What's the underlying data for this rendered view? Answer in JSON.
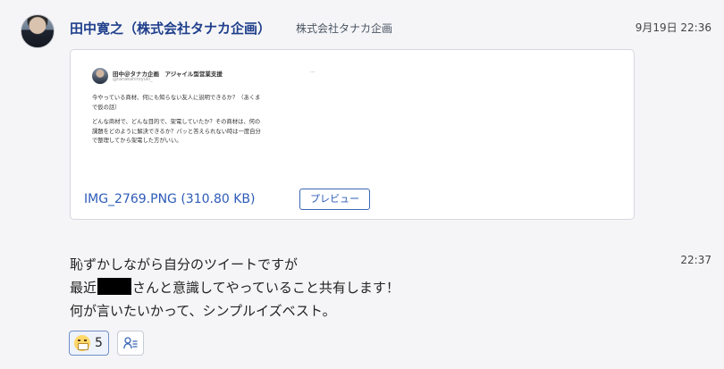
{
  "message": {
    "sender_name": "田中寛之（株式会社タナカ企画）",
    "sender_org": "株式会社タナカ企画",
    "timestamp": "9月19日 22:36"
  },
  "attachment": {
    "tweet": {
      "name": "田中＠タナカ企画　アジャイル型営業支援",
      "handle": "@tanakahiroyuki_",
      "more": "···",
      "paragraph_1": "今やっている商材、何にも知らない友人に説明できるか？（あくまで仮の話）",
      "paragraph_2": "どんな商材で、どんな目的で、架電していたか？その商材は、何の課題をどのように解決できるか？パッと答えられない時は一度自分で整理してから架電した方がいい。"
    },
    "file_name": "IMG_2769.PNG (310.80 KB)",
    "preview_label": "プレビュー"
  },
  "followup": {
    "timestamp": "22:37",
    "line_1": "恥ずかしながら自分のツイートですが",
    "line_2_prefix": "最近",
    "line_2_suffix": "さんと意識してやっていること共有します！",
    "line_3": "何が言いたいかって、シンプルイズベスト。"
  },
  "reactions": {
    "emoji_icon": "grimacing-face-icon",
    "count": "5",
    "read_icon": "read-status-person-list-icon"
  },
  "colors": {
    "accent": "#2d5bb8",
    "name": "#1f3f8c",
    "background": "#f5f5f7"
  }
}
